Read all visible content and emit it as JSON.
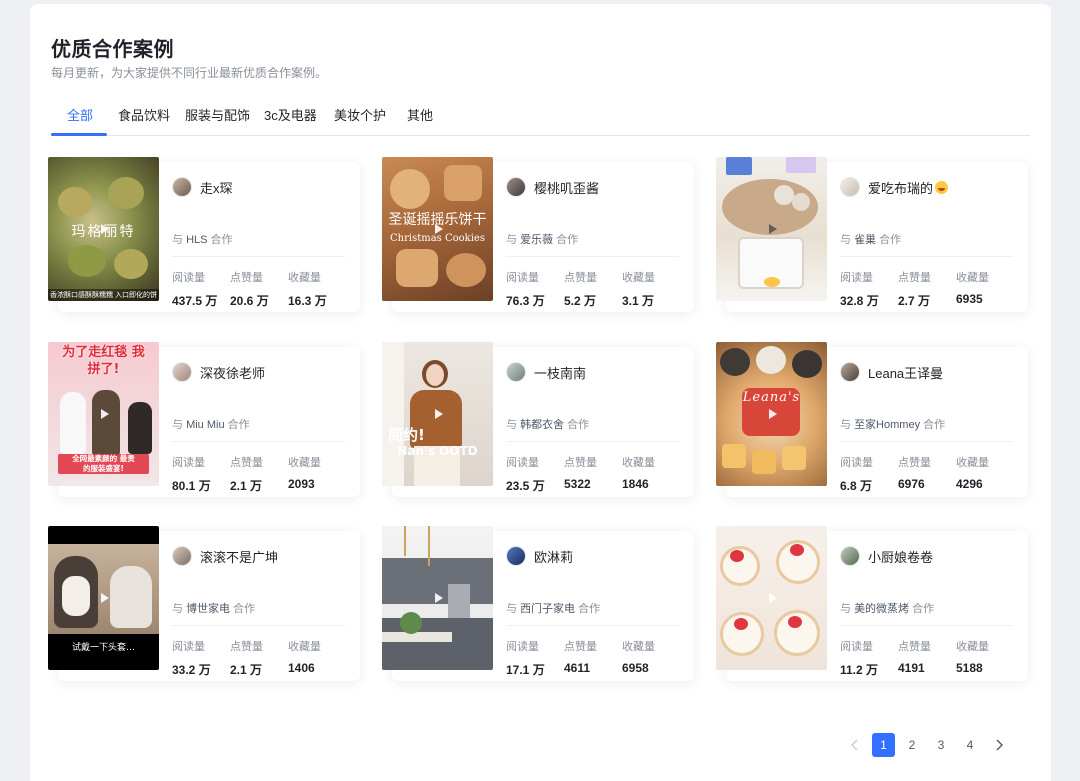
{
  "header": {
    "title": "优质合作案例",
    "subtitle": "每月更新，为大家提供不同行业最新优质合作案例。"
  },
  "tabs": [
    {
      "label": "全部",
      "active": true
    },
    {
      "label": "食品饮料"
    },
    {
      "label": "服装与配饰"
    },
    {
      "label": "3c及电器"
    },
    {
      "label": "美妆个护"
    },
    {
      "label": "其他"
    }
  ],
  "stat_labels": {
    "reads": "阅读量",
    "likes": "点赞量",
    "favorites": "收藏量"
  },
  "collab_prefix": "与",
  "collab_suffix": "合作",
  "cards": [
    {
      "author": "走x琛",
      "brand": "HLS",
      "reads": "437.5 万",
      "likes": "20.6 万",
      "favorites": "16.3 万",
      "thumb_caption": "玛格丽特",
      "thumb_footer": "香浓酥口感酥酥糯糯 入口即化的饼"
    },
    {
      "author": "樱桃叽歪酱",
      "brand": "爱乐薇",
      "reads": "76.3 万",
      "likes": "5.2 万",
      "favorites": "3.1 万",
      "thumb_caption": "圣诞摇摇乐饼干",
      "thumb_footer": "Christmas Cookies"
    },
    {
      "author": "爱吃布瑞的",
      "brand": "雀巢",
      "reads": "32.8 万",
      "likes": "2.7 万",
      "favorites": "6935"
    },
    {
      "author": "深夜徐老师",
      "brand": "Miu Miu",
      "reads": "80.1 万",
      "likes": "2.1 万",
      "favorites": "2093",
      "thumb_caption": "为了走红毯 我拼了!",
      "thumb_footer": "全网最素颜的 最贵的服装盛宴!"
    },
    {
      "author": "一枝南南",
      "brand": "韩都衣舍",
      "reads": "23.5 万",
      "likes": "5322",
      "favorites": "1846",
      "thumb_caption": "简约!",
      "thumb_footer": "Nan's OOTD"
    },
    {
      "author": "Leana王译曼",
      "brand": "至家Hommey",
      "reads": "6.8 万",
      "likes": "6976",
      "favorites": "4296",
      "thumb_caption": "Leana's"
    },
    {
      "author": "滚滚不是广坤",
      "brand": "博世家电",
      "reads": "33.2 万",
      "likes": "2.1 万",
      "favorites": "1406",
      "thumb_footer": "试戴一下头套…"
    },
    {
      "author": "欧淋莉",
      "brand": "西门子家电",
      "reads": "17.1 万",
      "likes": "4611",
      "favorites": "6958"
    },
    {
      "author": "小厨娘卷卷",
      "brand": "美的微蒸烤",
      "reads": "11.2 万",
      "likes": "4191",
      "favorites": "5188"
    }
  ],
  "pagination": {
    "pages": [
      "1",
      "2",
      "3",
      "4"
    ],
    "current": "1"
  },
  "colors": {
    "accent": "#3370ff",
    "text": "#1f2329",
    "muted": "#8a8f99"
  }
}
